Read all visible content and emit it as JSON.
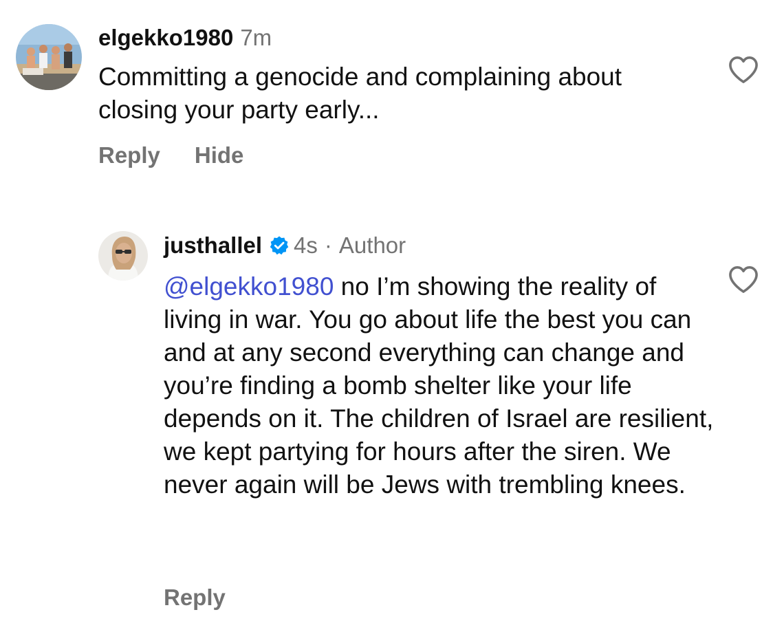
{
  "comments": [
    {
      "username": "elgekko1980",
      "time": "7m",
      "text": "Committing a genocide and complaining about closing your party early...",
      "actions": {
        "reply": "Reply",
        "hide": "Hide"
      }
    },
    {
      "username": "justhallel",
      "verified": true,
      "time": "4s",
      "separator": "·",
      "author_label": "Author",
      "mention": "@elgekko1980",
      "text": " no I’m showing the reality of living in war. You go about life the best you can and at any second everything can change and you’re finding a bomb shelter like your life depends on it. The children of Israel are resilient, we kept partying for hours after the siren. We never again will be Jews with trembling knees.",
      "actions": {
        "reply": "Reply"
      }
    }
  ],
  "icons": {
    "like": "heart-outline-icon",
    "verified": "verified-badge-icon"
  },
  "colors": {
    "text": "#111111",
    "secondary": "#737373",
    "mention": "#4150d0",
    "verified": "#0095f6"
  }
}
